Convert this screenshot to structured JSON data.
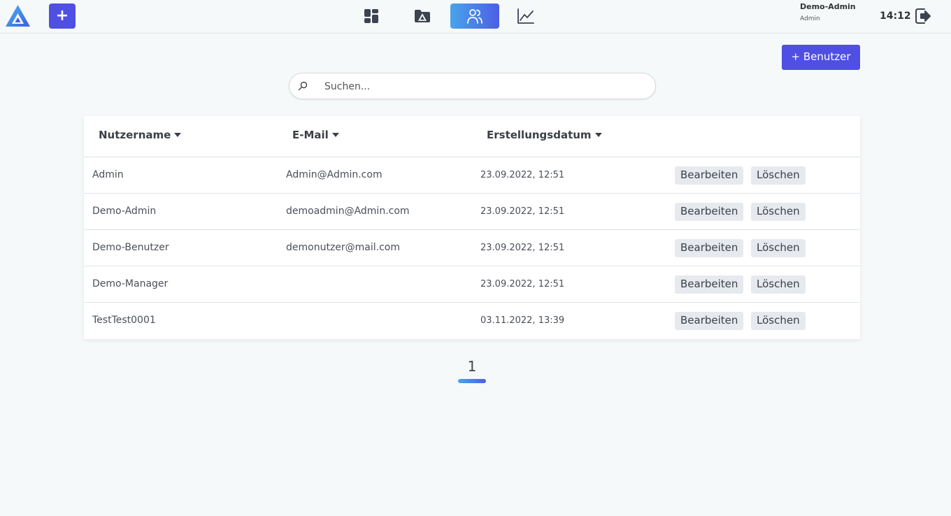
{
  "header": {
    "add_label": "+",
    "nav": [
      {
        "icon": "dashboard-icon",
        "active": false
      },
      {
        "icon": "folder-icon",
        "active": false
      },
      {
        "icon": "users-icon",
        "active": true
      },
      {
        "icon": "chart-icon",
        "active": false
      }
    ],
    "user_name": "Demo-Admin",
    "user_role": "Admin",
    "time": "14:12"
  },
  "actions": {
    "new_user_label": "+ Benutzer"
  },
  "search": {
    "placeholder": "Suchen..."
  },
  "table": {
    "columns": [
      "Nutzername",
      "E-Mail",
      "Erstellungsdatum"
    ],
    "rows": [
      {
        "username": "Admin",
        "email": "Admin@Admin.com",
        "created": "23.09.2022, 12:51"
      },
      {
        "username": "Demo-Admin",
        "email": "demoadmin@Admin.com",
        "created": "23.09.2022, 12:51"
      },
      {
        "username": "Demo-Benutzer",
        "email": "demonutzer@mail.com",
        "created": "23.09.2022, 12:51"
      },
      {
        "username": "Demo-Manager",
        "email": "",
        "created": "23.09.2022, 12:51"
      },
      {
        "username": "TestTest0001",
        "email": "",
        "created": "03.11.2022, 13:39"
      }
    ],
    "edit_label": "Bearbeiten",
    "delete_label": "Löschen"
  },
  "pagination": {
    "current": "1"
  },
  "colors": {
    "accent": "#4f4fe3",
    "gradient_start": "#4aa3ea",
    "gradient_end": "#4b5fe6",
    "background": "#f6f9fa"
  }
}
